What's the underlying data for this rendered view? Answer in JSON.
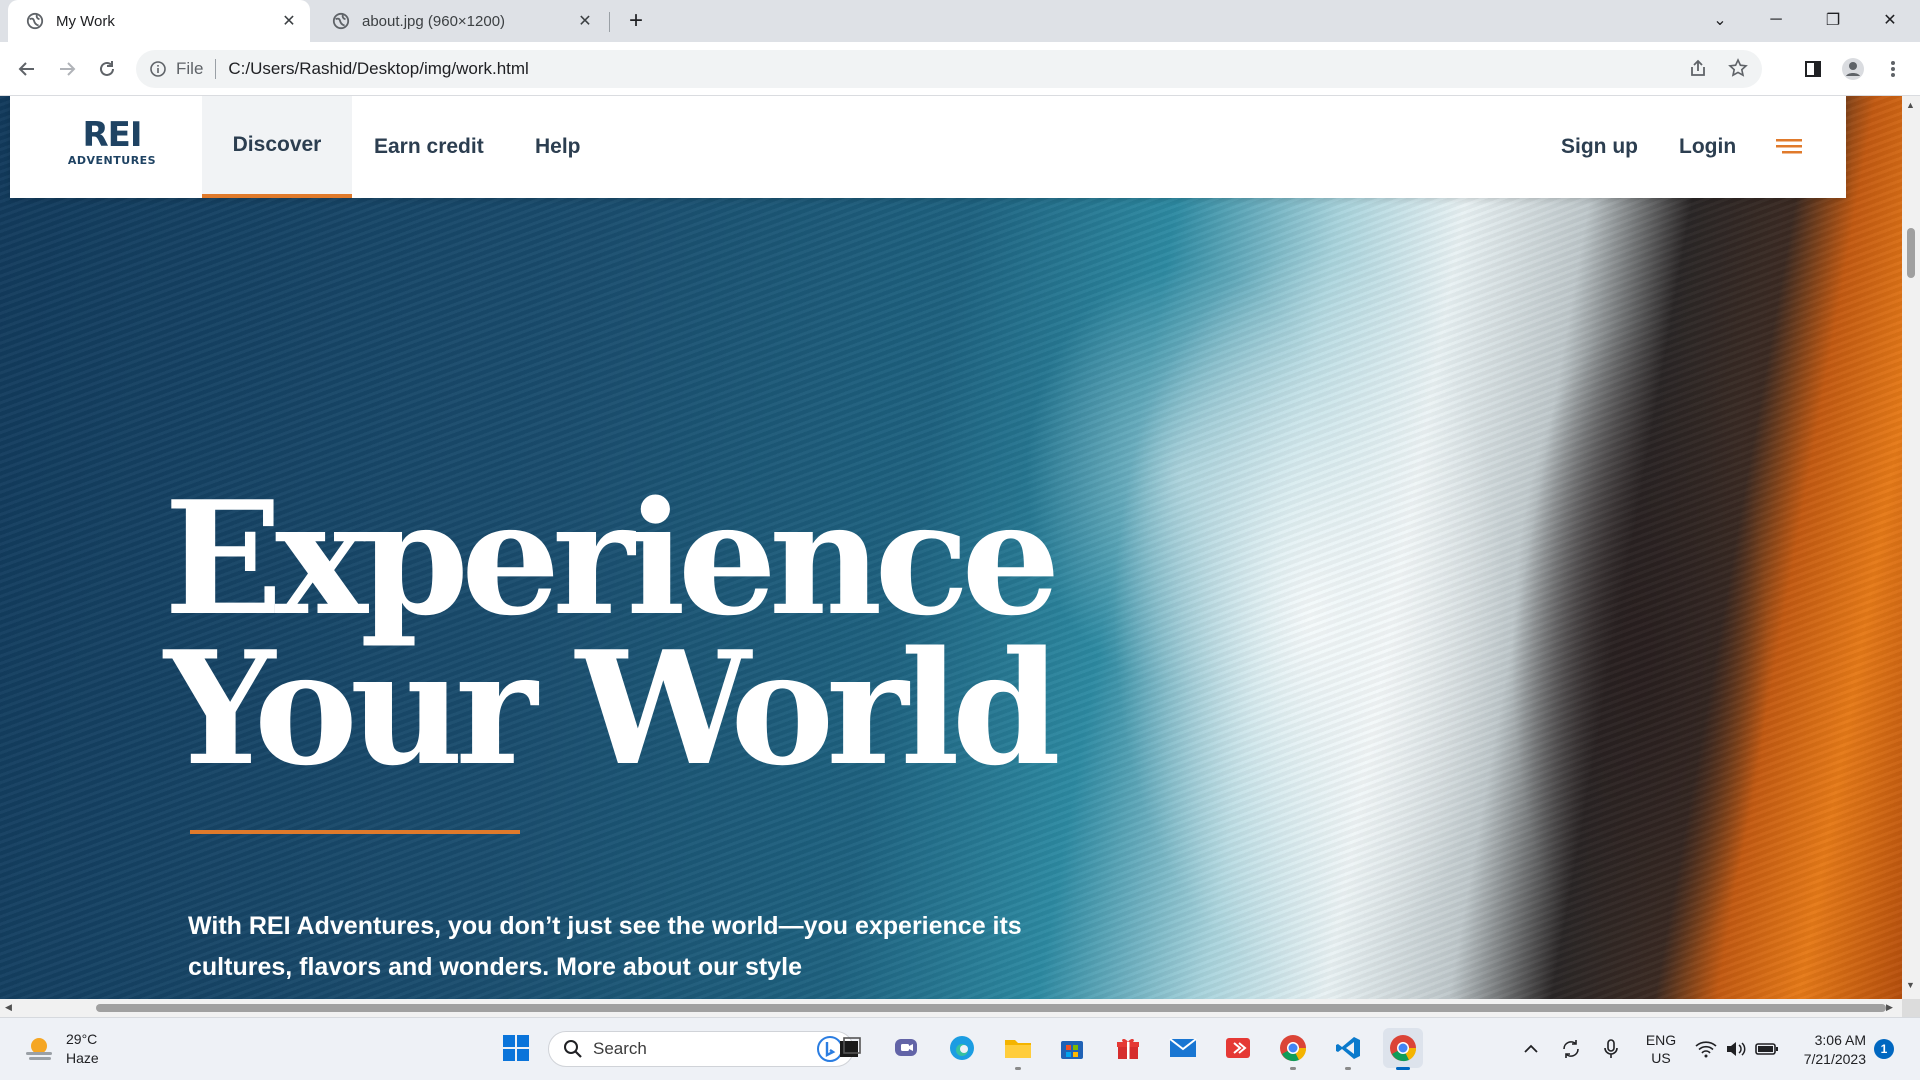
{
  "browser": {
    "tabs": [
      {
        "title": "My Work",
        "active": true
      },
      {
        "title": "about.jpg (960×1200)",
        "active": false
      }
    ],
    "address": {
      "scheme": "File",
      "url": "C:/Users/Rashid/Desktop/img/work.html"
    },
    "icons": {
      "back": "arrow-left-icon",
      "forward": "arrow-right-icon",
      "reload": "reload-icon",
      "share": "share-icon",
      "bookmark": "star-icon",
      "sidepanel": "side-panel-icon",
      "profile": "profile-icon",
      "menu": "kebab-menu-icon"
    }
  },
  "site": {
    "logo": {
      "line1": "REI",
      "line2": "ADVENTURES"
    },
    "nav": [
      "Discover",
      "Earn credit",
      "Help"
    ],
    "auth": {
      "signup": "Sign up",
      "login": "Login"
    },
    "hero": {
      "headline_line1": "Experience",
      "headline_line2": "Your World",
      "blurb_line1": "With REI Adventures, you don’t just see the world—you experience its",
      "blurb_line2": "cultures, flavors and wonders. More about our style"
    },
    "colors": {
      "brand": "#1f4363",
      "accent": "#e07a2b",
      "nav_text": "#2c3e50"
    }
  },
  "taskbar": {
    "weather": {
      "temp": "29°C",
      "condition": "Haze"
    },
    "search_label": "Search",
    "apps": [
      "start-icon",
      "bing-icon",
      "task-view-icon",
      "teams-icon",
      "edge-icon",
      "file-explorer-icon",
      "store-icon",
      "gift-icon",
      "mail-icon",
      "app-icon",
      "chrome-icon",
      "vscode-icon",
      "chrome-icon"
    ],
    "tray": {
      "lang_top": "ENG",
      "lang_bottom": "US"
    },
    "clock": {
      "time": "3:06 AM",
      "date": "7/21/2023"
    },
    "notifications": "1"
  }
}
